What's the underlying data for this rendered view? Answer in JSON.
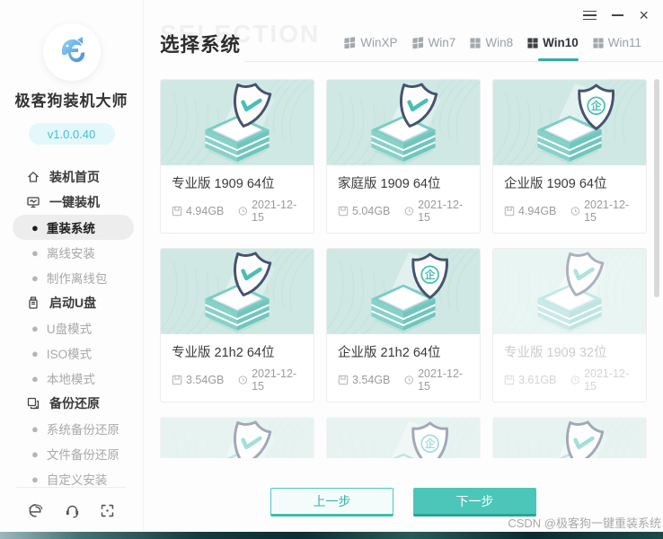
{
  "app": {
    "name": "极客狗装机大师",
    "version": "v1.0.0.40",
    "logo_icon": "dog-g-logo"
  },
  "window_controls": {
    "menu_icon": "hamburger-menu-icon",
    "minimize_icon": "minimize-icon",
    "close_glyph": "×"
  },
  "sidebar": {
    "menu": [
      {
        "label": "装机首页",
        "type": "section",
        "icon": "home-icon",
        "active": false
      },
      {
        "label": "一键装机",
        "type": "section",
        "icon": "monitor-icon",
        "active": false
      },
      {
        "label": "重装系统",
        "type": "sub",
        "active": true
      },
      {
        "label": "离线安装",
        "type": "sub",
        "active": false
      },
      {
        "label": "制作离线包",
        "type": "sub",
        "active": false
      },
      {
        "label": "启动U盘",
        "type": "section",
        "icon": "usb-drive-icon",
        "active": false
      },
      {
        "label": "U盘模式",
        "type": "sub",
        "active": false
      },
      {
        "label": "ISO模式",
        "type": "sub",
        "active": false
      },
      {
        "label": "本地模式",
        "type": "sub",
        "active": false
      },
      {
        "label": "备份还原",
        "type": "section",
        "icon": "backup-restore-icon",
        "active": false
      },
      {
        "label": "系统备份还原",
        "type": "sub",
        "active": false
      },
      {
        "label": "文件备份还原",
        "type": "sub",
        "active": false
      },
      {
        "label": "自定义安装",
        "type": "sub",
        "active": false
      }
    ],
    "footer_icons": [
      "ie-browser-icon",
      "support-headset-icon",
      "scan-qr-icon"
    ]
  },
  "header": {
    "title": "选择系统",
    "background_watermark": "SELECTION",
    "tabs": [
      {
        "label": "WinXP",
        "icon": "windows-flag-icon",
        "active": false
      },
      {
        "label": "Win7",
        "icon": "windows-flag-icon",
        "active": false
      },
      {
        "label": "Win8",
        "icon": "windows-logo-icon",
        "active": false
      },
      {
        "label": "Win10",
        "icon": "windows-logo-icon",
        "active": true
      },
      {
        "label": "Win11",
        "icon": "windows-logo-icon",
        "active": false
      }
    ]
  },
  "cards": [
    {
      "title": "专业版 1909 64位",
      "size": "4.94GB",
      "date": "2021-12-15",
      "badge": "check",
      "faded": false
    },
    {
      "title": "家庭版 1909 64位",
      "size": "5.04GB",
      "date": "2021-12-15",
      "badge": "check",
      "faded": false
    },
    {
      "title": "企业版 1909 64位",
      "size": "4.94GB",
      "date": "2021-12-15",
      "badge": "enterprise",
      "faded": false
    },
    {
      "title": "专业版 21h2 64位",
      "size": "3.54GB",
      "date": "2021-12-15",
      "badge": "check",
      "faded": false
    },
    {
      "title": "企业版 21h2 64位",
      "size": "3.54GB",
      "date": "2021-12-15",
      "badge": "enterprise",
      "faded": false
    },
    {
      "title": "专业版 1909 32位",
      "size": "3.61GB",
      "date": "2021-12-15",
      "badge": "check",
      "faded": true
    },
    {
      "badge": "check",
      "faded": true,
      "partial": true
    },
    {
      "badge": "enterprise",
      "faded": true,
      "partial": true
    },
    {
      "badge": "check",
      "faded": true,
      "partial": true
    }
  ],
  "card_meta_icons": {
    "size": "disk-icon",
    "date": "clock-icon"
  },
  "actions": {
    "prev_label": "上一步",
    "next_label": "下一步"
  },
  "footer_watermark": "CSDN @极客狗一键重装系统",
  "colors": {
    "accent": "#3fb8ae",
    "accent_button": "#4bc6b9",
    "accent_button_shadow": "#2da397",
    "tab_underline": "#35aca4",
    "card_image_bg": "#cfe8e4",
    "box_teal": "#7bcdc5",
    "shield_outline": "#46536f",
    "version_text": "#3ec0d8",
    "version_bg": "#e4f7fa",
    "selected_menu_bg": "#ededed",
    "muted_text": "#9b9b9b"
  }
}
